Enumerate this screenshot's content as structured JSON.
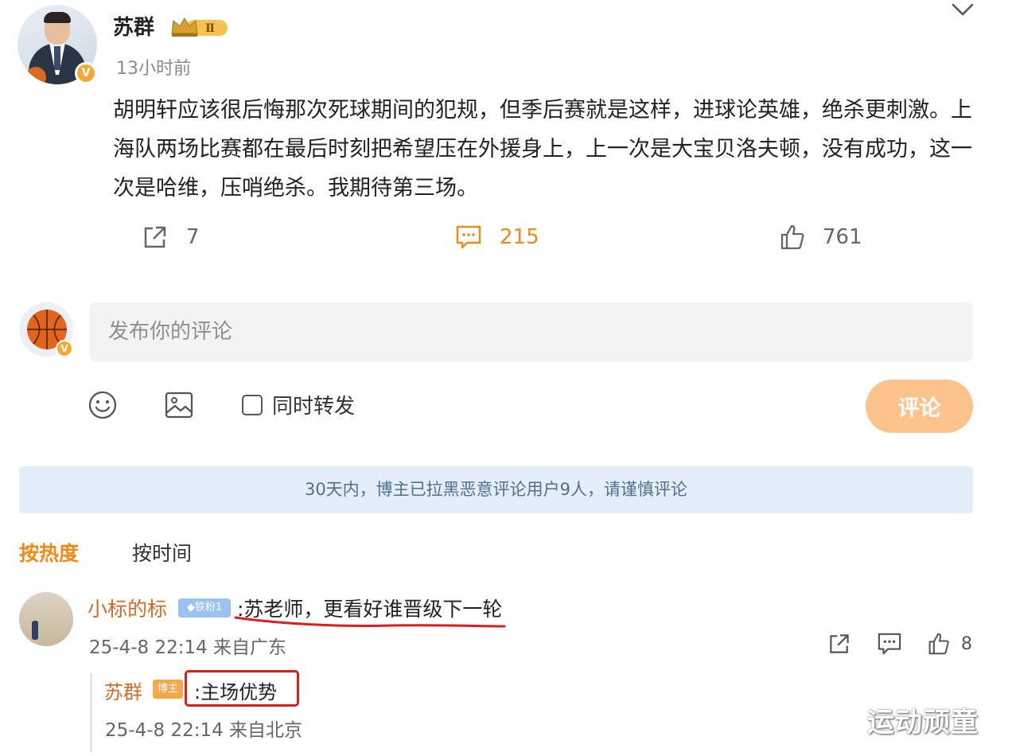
{
  "post": {
    "author": "苏群",
    "level_badge": "Ⅱ",
    "verified_badge": "V",
    "time": "13小时前",
    "text": "胡明轩应该很后悔那次死球期间的犯规，但季后赛就是这样，进球论英雄，绝杀更刺激。上海队两场比赛都在最后时刻把希望压在外援身上，上一次是大宝贝洛夫顿，没有成功，这一次是哈维，压哨绝杀。我期待第三场。",
    "actions": {
      "share_count": "7",
      "comment_count": "215",
      "like_count": "761"
    }
  },
  "composer": {
    "placeholder": "发布你的评论",
    "repost_label": "同时转发",
    "submit_label": "评论",
    "verified_badge": "V"
  },
  "notice": "30天内，博主已拉黑恶意评论用户9人，请谨慎评论",
  "sort": {
    "hot": "按热度",
    "time": "按时间"
  },
  "comment": {
    "user": "小标的标",
    "fan_badge": "◆铁粉1",
    "text": ":苏老师，更看好谁晋级下一轮",
    "meta": "25-4-8 22:14 来自广东",
    "like_count": "8",
    "reply": {
      "user": "苏群",
      "badge": "博主",
      "text": ":主场优势",
      "meta": "25-4-8 22:14 来自北京"
    }
  },
  "watermark": "运动顽童",
  "colors": {
    "accent": "#f08a17",
    "username": "#d56a2a",
    "notice_bg": "#e3eef8",
    "annotation_red": "#d7211a"
  }
}
